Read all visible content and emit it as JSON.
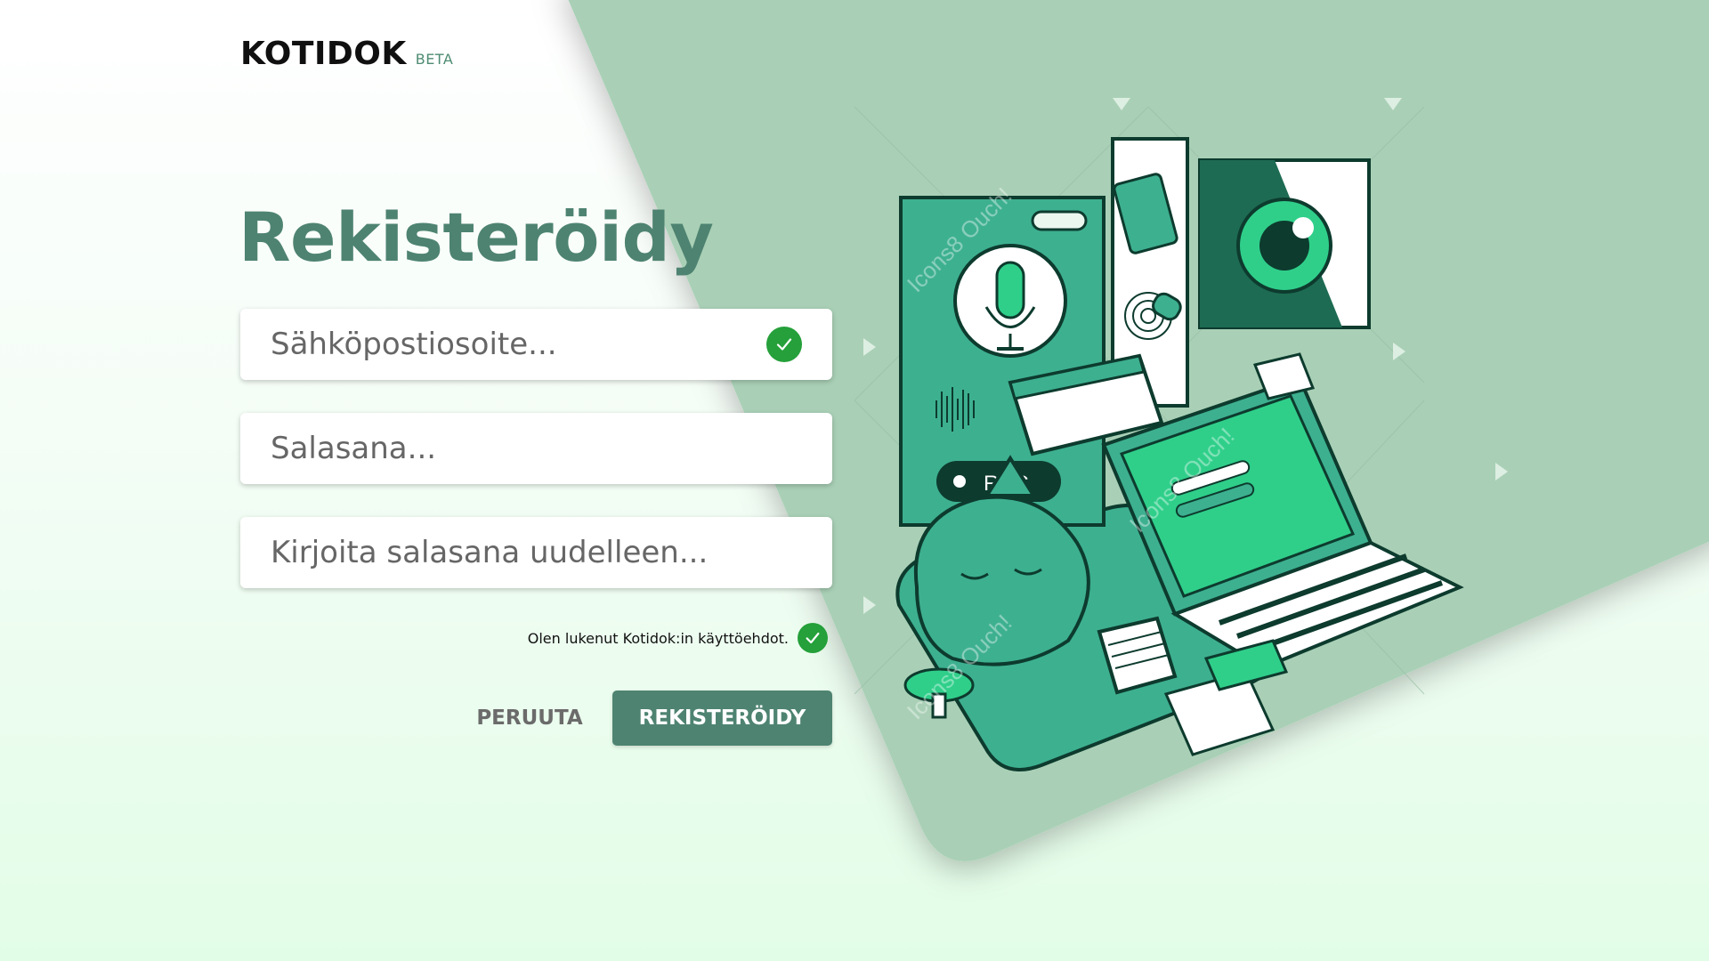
{
  "brand": {
    "name": "KOTIDOK",
    "badge": "BETA"
  },
  "page": {
    "title": "Rekisteröidy"
  },
  "form": {
    "email": {
      "placeholder": "Sähköpostiosoite...",
      "value": "",
      "valid": true
    },
    "password": {
      "placeholder": "Salasana...",
      "value": ""
    },
    "password_repeat": {
      "placeholder": "Kirjoita salasana uudelleen...",
      "value": ""
    },
    "terms": {
      "label": "Olen lukenut Kotidok:in käyttöehdot.",
      "checked": true
    }
  },
  "actions": {
    "cancel_label": "PERUUTA",
    "submit_label": "REKISTERÖIDY"
  },
  "illustration": {
    "rec_label": "REC",
    "watermark": "Icons8 Ouch!"
  },
  "icons": {
    "email_status": "check-circle-icon",
    "terms_status": "check-circle-icon",
    "illustration": "voice-recorder-biometric-illustration"
  },
  "colors": {
    "brand": "#4e8371",
    "accent": "#3db090",
    "success": "#25a03a",
    "panel": "#a9d0b6",
    "background_bottom": "#e2fde7"
  }
}
